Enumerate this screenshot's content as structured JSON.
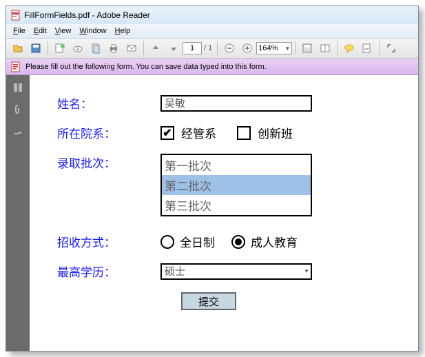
{
  "window": {
    "title": "FillFormFields.pdf - Adobe Reader"
  },
  "menu": {
    "file": "File",
    "edit": "Edit",
    "view": "View",
    "window": "Window",
    "help": "Help"
  },
  "toolbar": {
    "page_current": "1",
    "page_total": "/ 1",
    "zoom": "164%"
  },
  "infobar": {
    "message": "Please fill out the following form. You can save data typed into this form."
  },
  "form": {
    "name": {
      "label": "姓名：",
      "value": "吴敏"
    },
    "dept": {
      "label": "所在院系：",
      "opt1": "经管系",
      "opt2": "创新班"
    },
    "batch": {
      "label": "录取批次：",
      "opt1": "第一批次",
      "opt2": "第二批次",
      "opt3": "第三批次"
    },
    "mode": {
      "label": "招收方式：",
      "opt1": "全日制",
      "opt2": "成人教育"
    },
    "edu": {
      "label": "最高学历：",
      "value": "硕士"
    },
    "submit": "提交"
  }
}
